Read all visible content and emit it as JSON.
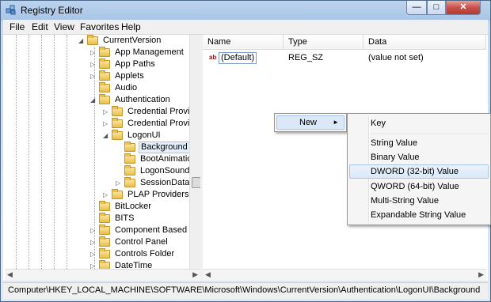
{
  "window": {
    "title": "Registry Editor",
    "min_glyph": "—",
    "max_glyph": "□",
    "close_glyph": "✕"
  },
  "menubar": [
    "File",
    "Edit",
    "View",
    "Favorites",
    "Help"
  ],
  "tree": {
    "nodes": [
      {
        "label": "CurrentVersion",
        "expander": "◢"
      },
      {
        "label": "App Management",
        "expander": "▷"
      },
      {
        "label": "App Paths",
        "expander": "▷"
      },
      {
        "label": "Applets",
        "expander": "▷"
      },
      {
        "label": "Audio",
        "expander": ""
      },
      {
        "label": "Authentication",
        "expander": "◢"
      },
      {
        "label": "Credential Provide",
        "expander": "▷"
      },
      {
        "label": "Credential Provide",
        "expander": "▷"
      },
      {
        "label": "LogonUI",
        "expander": "◢"
      },
      {
        "label": "Background",
        "expander": "",
        "selected": true
      },
      {
        "label": "BootAnimatio",
        "expander": ""
      },
      {
        "label": "LogonSoundP",
        "expander": ""
      },
      {
        "label": "SessionData",
        "expander": "▷"
      },
      {
        "label": "PLAP Providers",
        "expander": "▷"
      },
      {
        "label": "BitLocker",
        "expander": ""
      },
      {
        "label": "BITS",
        "expander": ""
      },
      {
        "label": "Component Based Se",
        "expander": "▷"
      },
      {
        "label": "Control Panel",
        "expander": "▷"
      },
      {
        "label": "Controls Folder",
        "expander": "▷"
      },
      {
        "label": "DateTime",
        "expander": "▷"
      }
    ]
  },
  "list": {
    "columns": [
      "Name",
      "Type",
      "Data"
    ],
    "rows": [
      {
        "name": "(Default)",
        "type": "REG_SZ",
        "data": "(value not set)",
        "icon": "ab"
      }
    ]
  },
  "context_menu": {
    "primary": {
      "label": "New",
      "arrow": "►"
    },
    "submenu": [
      "Key",
      "String Value",
      "Binary Value",
      "DWORD (32-bit) Value",
      "QWORD (64-bit) Value",
      "Multi-String Value",
      "Expandable String Value"
    ],
    "highlighted_index": 3
  },
  "statusbar": {
    "path": "Computer\\HKEY_LOCAL_MACHINE\\SOFTWARE\\Microsoft\\Windows\\CurrentVersion\\Authentication\\LogonUI\\Background"
  }
}
